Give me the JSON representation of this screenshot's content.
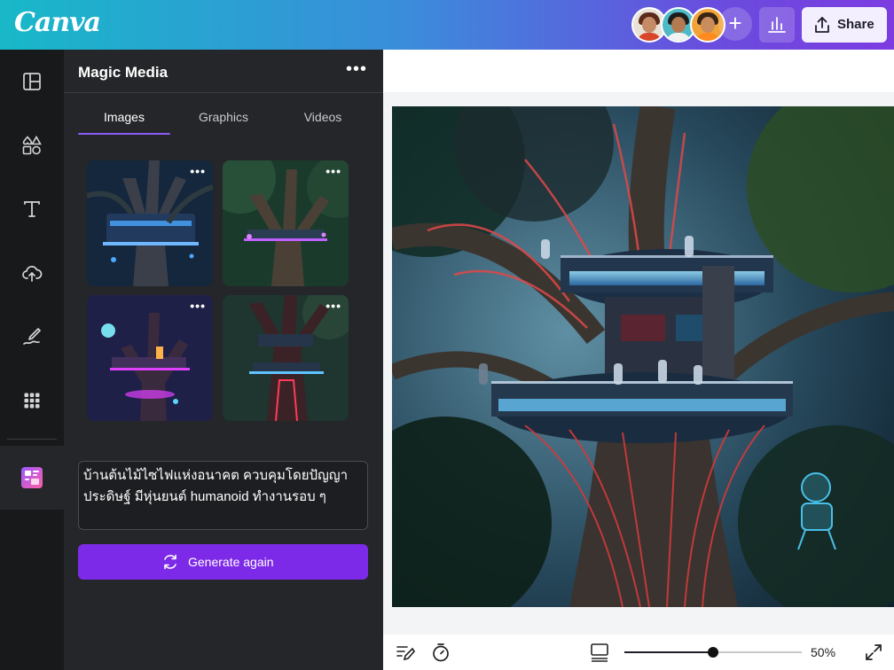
{
  "app": {
    "logo": "Canva"
  },
  "header": {
    "share_label": "Share",
    "collaborators": [
      {
        "name": "collaborator-1",
        "ring": "#e9e2d7",
        "hair": "#5a2a1a",
        "body": "#d9472b"
      },
      {
        "name": "collaborator-2",
        "ring": "#4fb9c8",
        "hair": "#1d1d1d",
        "body": "#f2f2f2"
      },
      {
        "name": "collaborator-3",
        "ring": "#f0a33a",
        "hair": "#3a2415",
        "body": "#ff8a1f"
      }
    ],
    "add_icon": "plus-icon",
    "analytics_icon": "bar-chart-icon"
  },
  "sidebar": {
    "items": [
      {
        "icon": "layout-panels-icon"
      },
      {
        "icon": "elements-shapes-icon"
      },
      {
        "icon": "text-icon"
      },
      {
        "icon": "upload-cloud-icon"
      },
      {
        "icon": "draw-pen-icon"
      },
      {
        "icon": "apps-grid-icon"
      },
      {
        "icon": "magic-media-app-icon"
      }
    ]
  },
  "panel": {
    "title": "Magic Media",
    "more_label": "•••",
    "tabs": [
      {
        "label": "Images",
        "active": true
      },
      {
        "label": "Graphics",
        "active": false
      },
      {
        "label": "Videos",
        "active": false
      }
    ],
    "results": [
      {
        "more_label": "•••",
        "glow": "#4aa8ff",
        "tone": "#1c3550"
      },
      {
        "more_label": "•••",
        "glow": "#c060ff",
        "tone": "#1a3a2c"
      },
      {
        "more_label": "•••",
        "glow": "#e040ff",
        "tone": "#1f2048"
      },
      {
        "more_label": "•••",
        "glow": "#ff3a5a",
        "tone": "#1e3530"
      }
    ],
    "prompt_text": "บ้านต้นไม้ไซไฟแห่งอนาคต ควบคุมโดยปัญญาประดิษฐ์ มีหุ่นยนต์ humanoid ทำงานรอบ ๆ",
    "generate_label": "Generate again"
  },
  "bottombar": {
    "zoom_percent": 50,
    "zoom_label": "50%",
    "notes_icon": "notes-pen-icon",
    "timer_icon": "timer-icon",
    "pages_icon": "pages-grid-icon",
    "fullscreen_icon": "expand-icon"
  },
  "colors": {
    "accent": "#7d2ae8",
    "tab_underline": "#8b5cf6"
  }
}
